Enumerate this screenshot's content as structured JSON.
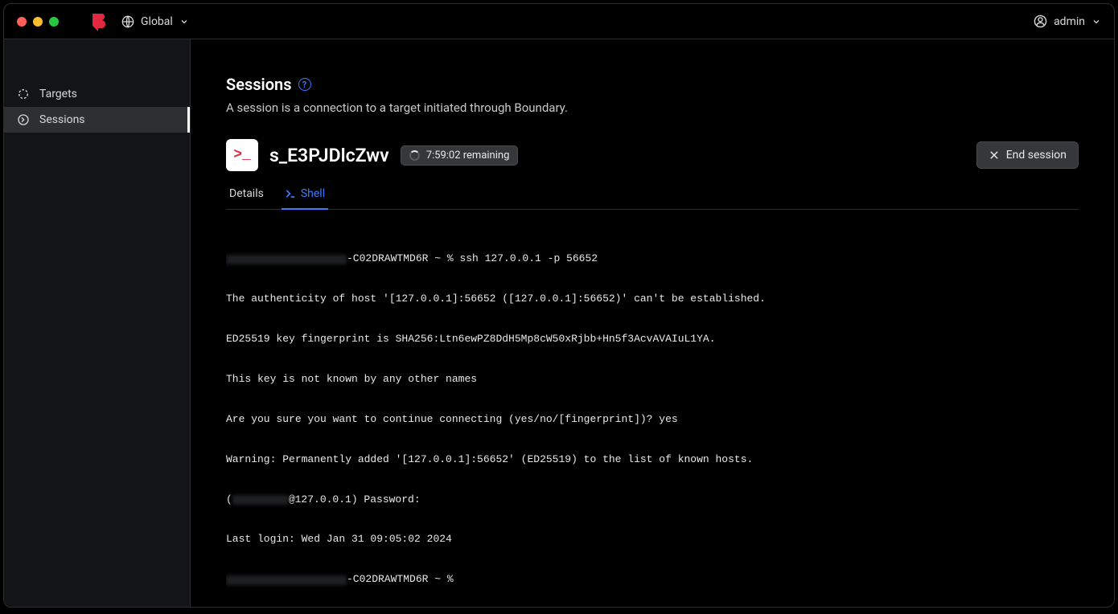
{
  "header": {
    "scope_label": "Global",
    "user_label": "admin"
  },
  "sidebar": {
    "items": [
      {
        "label": "Targets"
      },
      {
        "label": "Sessions"
      }
    ]
  },
  "page": {
    "title": "Sessions",
    "subtitle": "A session is a connection to a target initiated through Boundary."
  },
  "session": {
    "id": "s_E3PJDlcZwv",
    "time_remaining": "7:59:02 remaining",
    "end_button_label": "End session"
  },
  "tabs": {
    "details": "Details",
    "shell": "Shell"
  },
  "terminal": {
    "line1_suffix": "-C02DRAWTMD6R ~ % ssh 127.0.0.1 -p 56652",
    "line2": "The authenticity of host '[127.0.0.1]:56652 ([127.0.0.1]:56652)' can't be established.",
    "line3": "ED25519 key fingerprint is SHA256:Ltn6ewPZ8DdH5Mp8cW50xRjbb+Hn5f3AcvAVAIuL1YA.",
    "line4": "This key is not known by any other names",
    "line5": "Are you sure you want to continue connecting (yes/no/[fingerprint])? yes",
    "line6": "Warning: Permanently added '[127.0.0.1]:56652' (ED25519) to the list of known hosts.",
    "line7_prefix": "(",
    "line7_suffix": "@127.0.0.1) Password:",
    "line8": "Last login: Wed Jan 31 09:05:02 2024",
    "line9_suffix": "-C02DRAWTMD6R ~ %"
  }
}
